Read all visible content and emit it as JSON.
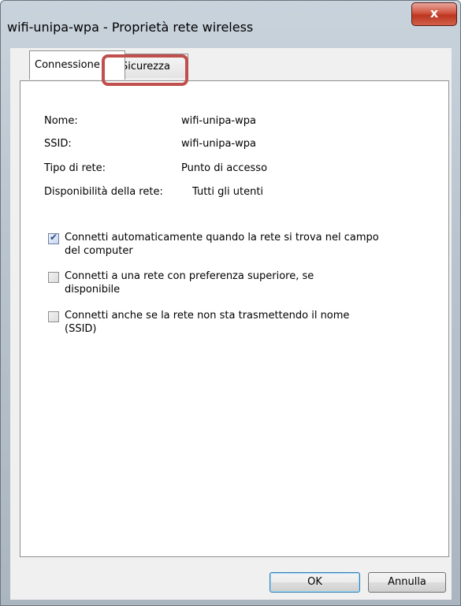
{
  "window": {
    "title": "wifi-unipa-wpa - Proprietà rete wireless"
  },
  "close_button": {
    "label": "x"
  },
  "tabs": [
    {
      "label": "Connessione"
    },
    {
      "label": "Sicurezza"
    }
  ],
  "properties": [
    {
      "label": "Nome:",
      "value": "wifi-unipa-wpa"
    },
    {
      "label": "SSID:",
      "value": "wifi-unipa-wpa"
    },
    {
      "label": "Tipo di rete:",
      "value": "Punto di accesso"
    },
    {
      "label": "Disponibilità della rete:",
      "value": "Tutti gli utenti"
    }
  ],
  "options": [
    {
      "label": "Connetti automaticamente quando la rete si trova nel campo del computer",
      "checked": true
    },
    {
      "label": "Connetti a una rete con preferenza superiore, se disponibile",
      "checked": false
    },
    {
      "label": "Connetti anche se la rete non sta trasmettendo il nome (SSID)",
      "checked": false
    }
  ],
  "buttons": {
    "ok": "OK",
    "cancel": "Annulla"
  },
  "colors": {
    "highlight": "#c0504d",
    "close": "#c8432f"
  }
}
